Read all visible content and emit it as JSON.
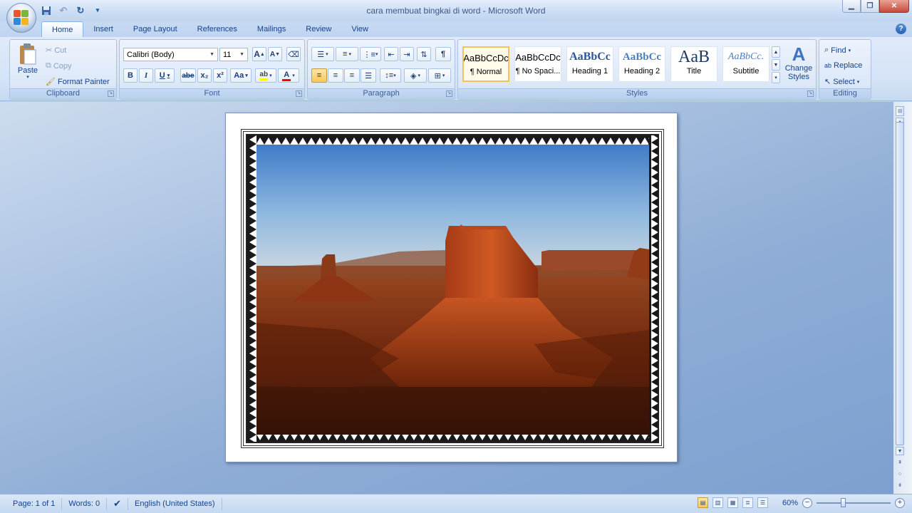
{
  "window": {
    "title": "cara membuat bingkai di word - Microsoft Word",
    "minimize_icon": "minimize-icon",
    "maximize_icon": "restore-icon",
    "close_icon": "close-icon"
  },
  "quick_access": [
    "save-icon",
    "undo-icon",
    "redo-icon",
    "customize-qat-icon"
  ],
  "tabs": [
    "Home",
    "Insert",
    "Page Layout",
    "References",
    "Mailings",
    "Review",
    "View"
  ],
  "active_tab": "Home",
  "ribbon": {
    "clipboard": {
      "label": "Clipboard",
      "paste": "Paste",
      "cut": "Cut",
      "copy": "Copy",
      "format_painter": "Format Painter"
    },
    "font": {
      "label": "Font",
      "font_name": "Calibri (Body)",
      "font_size": "11",
      "bold": "B",
      "italic": "I",
      "underline": "U",
      "strikethrough": "abe",
      "subscript": "x₂",
      "superscript": "x²",
      "change_case": "Aa",
      "grow": "A",
      "shrink": "A",
      "highlight_color": "#ffff00",
      "font_color": "#ff0000"
    },
    "paragraph": {
      "label": "Paragraph",
      "show_marks": "¶"
    },
    "styles": {
      "label": "Styles",
      "items": [
        {
          "preview": "AaBbCcDc",
          "name": "¶ Normal"
        },
        {
          "preview": "AaBbCcDc",
          "name": "¶ No Spaci..."
        },
        {
          "preview": "AaBbCc",
          "name": "Heading 1"
        },
        {
          "preview": "AaBbCc",
          "name": "Heading 2"
        },
        {
          "preview": "AaB",
          "name": "Title"
        },
        {
          "preview": "AaBbCc.",
          "name": "Subtitle"
        }
      ],
      "change_styles": "Change Styles"
    },
    "editing": {
      "label": "Editing",
      "find": "Find",
      "replace": "Replace",
      "select": "Select"
    }
  },
  "document": {
    "page_border": "art-border-zigzag",
    "image": "desert-butte-photo"
  },
  "status": {
    "page": "Page: 1 of 1",
    "words": "Words: 0",
    "proofing_icon": "proofing-check-icon",
    "language": "English (United States)",
    "zoom": "60%",
    "zoom_percent": 60
  },
  "colors": {
    "ribbon_bg": "#d4e3f6",
    "doc_bg": "#9ab5da",
    "accent": "#15428b",
    "selected": "#f8c75c"
  }
}
